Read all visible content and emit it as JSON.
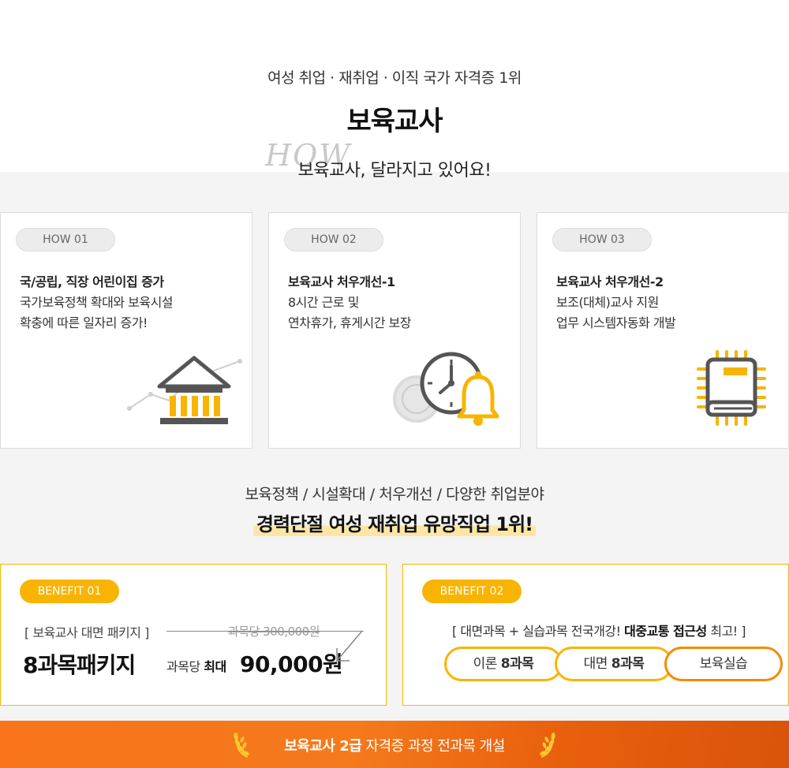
{
  "header": {
    "subtitle": "여성 취업 · 재취업 · 이직 국가 자격증 1위",
    "title": "보육교사",
    "how_deco": "HOW",
    "how_headline": "보육교사, 달라지고 있어요!"
  },
  "cards": [
    {
      "badge": "HOW 01",
      "title": "국/공립, 직장 어린이집 증가",
      "line1": "국가보육정책 확대와 보육시설",
      "line2": "확충에 따른 일자리 증가!",
      "icon": "bank-icon"
    },
    {
      "badge": "HOW 02",
      "title": "보육교사 처우개선-1",
      "line1": "8시간 근로 및",
      "line2": "연차휴가, 휴게시간 보장",
      "icon": "clock-bell-icon"
    },
    {
      "badge": "HOW 03",
      "title": "보육교사 처우개선-2",
      "line1": "보조(대체)교사 지원",
      "line2": "업무 시스템자동화 개발",
      "icon": "book-chip-icon"
    }
  ],
  "middle": {
    "subtitle": "보육정책 / 시설확대 / 처우개선 / 다양한 취업분야",
    "title": "경력단절 여성 재취업 유망직업 1위!"
  },
  "benefit1": {
    "badge": "BENEFIT 01",
    "bracket": "[ 보육교사 대면 패키지 ]",
    "big": "8과목패키지",
    "old_price": "과목당 300,000원",
    "price_label": "과목당",
    "price_label_bold": "최대",
    "price": "90,000원"
  },
  "benefit2": {
    "badge": "BENEFIT 02",
    "text_pre": "[ 대면과목 + 실습과목 전국개강!",
    "text_bold": "대중교통 접근성",
    "text_post": "최고! ]",
    "chips": [
      {
        "label": "이론",
        "bold": "8과목"
      },
      {
        "label": "대면",
        "bold": "8과목"
      },
      {
        "label": "보육실습",
        "bold": ""
      }
    ]
  },
  "footer": {
    "bold": "보육교사 2급",
    "text": "자격증 과정 전과목 개설"
  },
  "colors": {
    "accent": "#f8b400",
    "accent_dark": "#f08c00",
    "footer_orange": "#f47a1c",
    "highlight": "#fbe6a6",
    "icon_gray": "#555555"
  }
}
